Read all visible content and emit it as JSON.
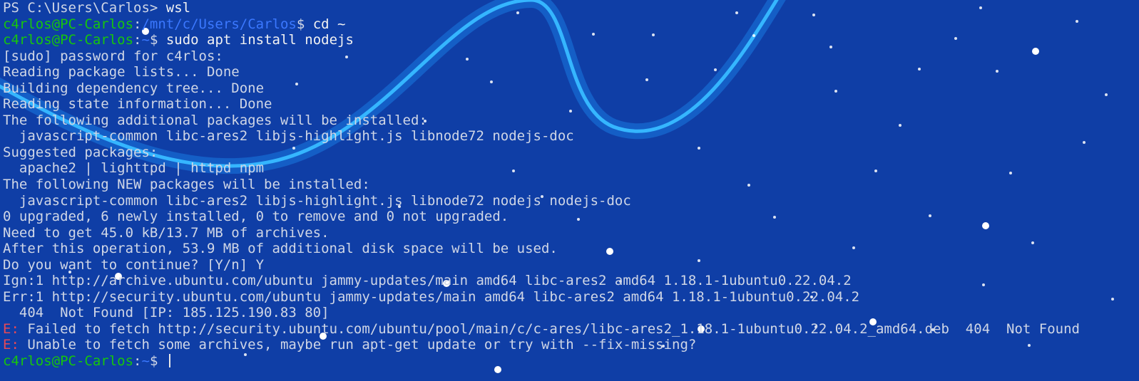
{
  "terminal": {
    "lines": [
      {
        "prompt": "PS C:\\Users\\Carlos> ",
        "text": "wsl"
      },
      {
        "user": "c4rlos@PC-Carlos",
        "sep": ":",
        "path": "/mnt/c/Users/Carlos",
        "sigil": "$ ",
        "text": "cd ~"
      },
      {
        "user": "c4rlos@PC-Carlos",
        "sep": ":",
        "path": "~",
        "sigil": "$ ",
        "text": "sudo apt install nodejs"
      },
      {
        "text": "[sudo] password for c4rlos:"
      },
      {
        "text": "Reading package lists... Done"
      },
      {
        "text": "Building dependency tree... Done"
      },
      {
        "text": "Reading state information... Done"
      },
      {
        "text": "The following additional packages will be installed:"
      },
      {
        "text": "  javascript-common libc-ares2 libjs-highlight.js libnode72 nodejs-doc"
      },
      {
        "text": "Suggested packages:"
      },
      {
        "text": "  apache2 | lighttpd | httpd npm"
      },
      {
        "text": "The following NEW packages will be installed:"
      },
      {
        "text": "  javascript-common libc-ares2 libjs-highlight.js libnode72 nodejs nodejs-doc"
      },
      {
        "text": "0 upgraded, 6 newly installed, 0 to remove and 0 not upgraded."
      },
      {
        "text": "Need to get 45.0 kB/13.7 MB of archives."
      },
      {
        "text": "After this operation, 53.9 MB of additional disk space will be used."
      },
      {
        "text": "Do you want to continue? [Y/n] Y"
      },
      {
        "text": "Ign:1 http://archive.ubuntu.com/ubuntu jammy-updates/main amd64 libc-ares2 amd64 1.18.1-1ubuntu0.22.04.2"
      },
      {
        "text": "Err:1 http://security.ubuntu.com/ubuntu jammy-updates/main amd64 libc-ares2 amd64 1.18.1-1ubuntu0.22.04.2"
      },
      {
        "text": "  404  Not Found [IP: 185.125.190.83 80]"
      },
      {
        "errlabel": "E:",
        "text": " Failed to fetch http://security.ubuntu.com/ubuntu/pool/main/c/c-ares/libc-ares2_1.18.1-1ubuntu0.22.04.2_amd64.deb  404  Not Found"
      },
      {
        "errlabel": "E:",
        "text": " Unable to fetch some archives, maybe run apt-get update or try with --fix-missing?"
      },
      {
        "user": "c4rlos@PC-Carlos",
        "sep": ":",
        "path": "~",
        "sigil": "$ ",
        "text": ""
      }
    ]
  },
  "colors": {
    "background": "#0f3ea6",
    "text": "#cfd6e6",
    "user": "#16c60c",
    "path": "#3b78ff",
    "error": "#e74856",
    "wave": "#1fa3ff"
  }
}
